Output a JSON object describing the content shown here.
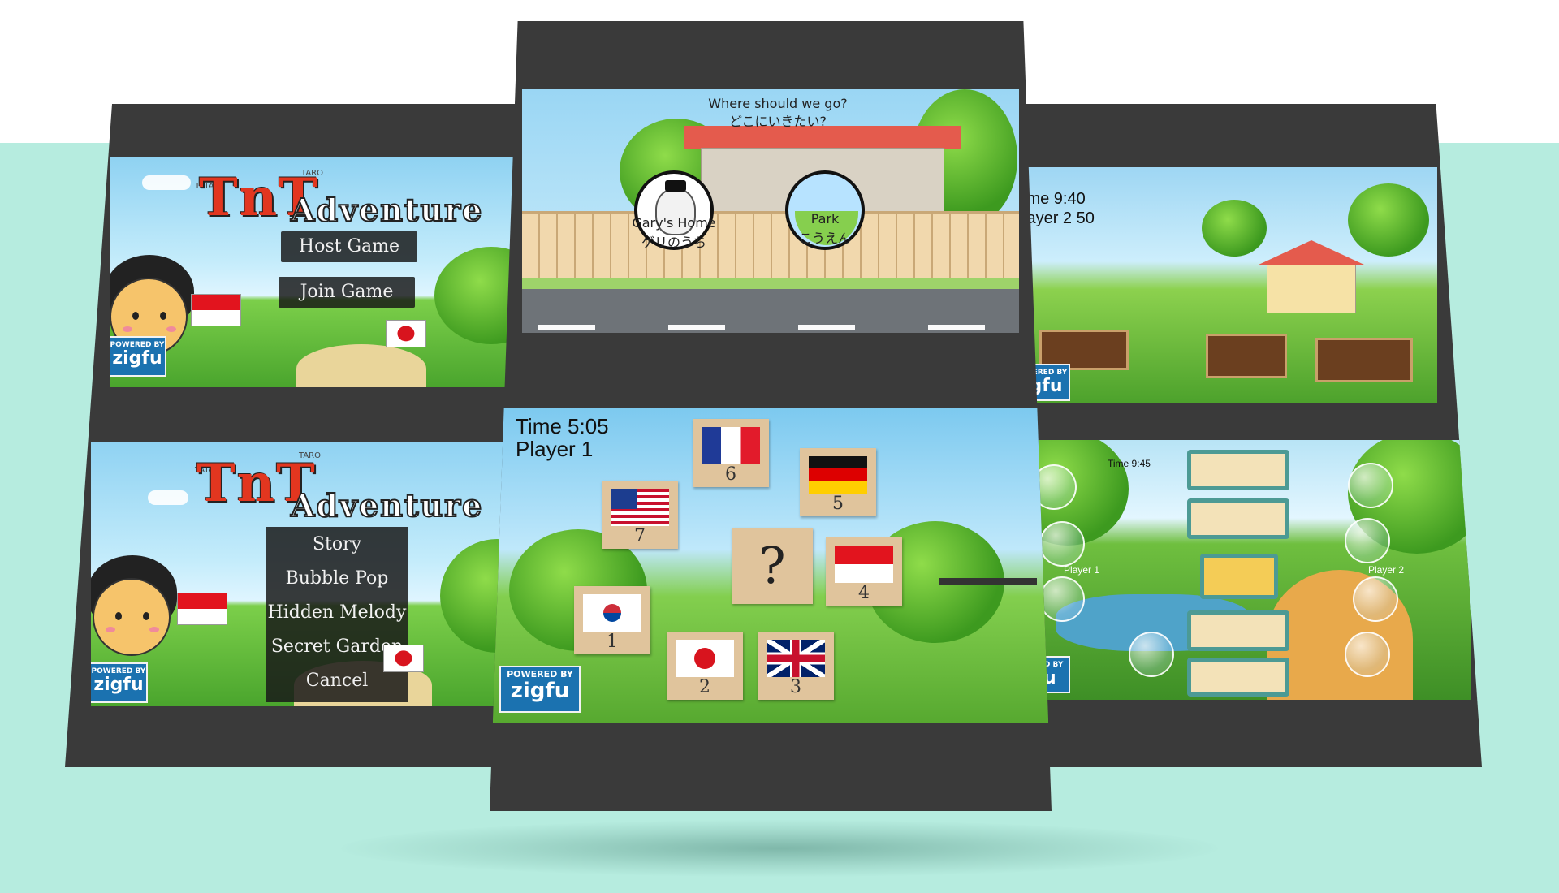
{
  "left_panel": {
    "title_screen": {
      "logo_tata": "TATA",
      "logo_tnt": "TnT",
      "logo_taro": "TARO",
      "logo_adventure": "Adventure",
      "buttons": [
        "Host Game",
        "Join Game"
      ],
      "badge_powered": "POWERED BY",
      "badge_brand": "zigfu"
    },
    "game_menu": {
      "logo_tata": "TATA",
      "logo_tnt": "TnT",
      "logo_taro": "TARO",
      "logo_adventure": "Adventure",
      "items": [
        "Story",
        "Bubble Pop",
        "Hidden Melody",
        "Secret Garden",
        "Cancel"
      ],
      "badge_powered": "POWERED BY",
      "badge_brand": "zigfu"
    }
  },
  "middle_panel": {
    "destination": {
      "prompt_en": "Where should we go?",
      "prompt_jp": "どこにいきたい?",
      "choices": [
        {
          "label_en": "Gary's Home",
          "label_jp": "ゲリのうち"
        },
        {
          "label_en": "Park",
          "label_jp": "こうえん"
        }
      ]
    },
    "flag_quiz": {
      "time": "Time 5:05",
      "player": "Player 1",
      "question_mark": "?",
      "cards": [
        {
          "num": "6",
          "flag": "france"
        },
        {
          "num": "5",
          "flag": "germany"
        },
        {
          "num": "7",
          "flag": "usa"
        },
        {
          "num": "4",
          "flag": "indonesia"
        },
        {
          "num": "1",
          "flag": "south-korea"
        },
        {
          "num": "2",
          "flag": "japan"
        },
        {
          "num": "3",
          "flag": "united-kingdom"
        }
      ],
      "badge_powered": "POWERED BY",
      "badge_brand": "zigfu"
    }
  },
  "right_panel": {
    "garden": {
      "time": "ime 9:40",
      "player": "layer 2 50",
      "badge_powered": "WERED BY",
      "badge_brand": "gfu"
    },
    "puzzle": {
      "time": "Time 9:45",
      "player1": "Player 1",
      "player2": "Player 2",
      "badge_powered": "ERED BY",
      "badge_brand": "fu"
    }
  },
  "colors": {
    "background_band": "#b6ecdf",
    "device_frame": "#3a3a3a",
    "card": "#e0c49c",
    "zigfu_blue": "#1b72b0"
  }
}
